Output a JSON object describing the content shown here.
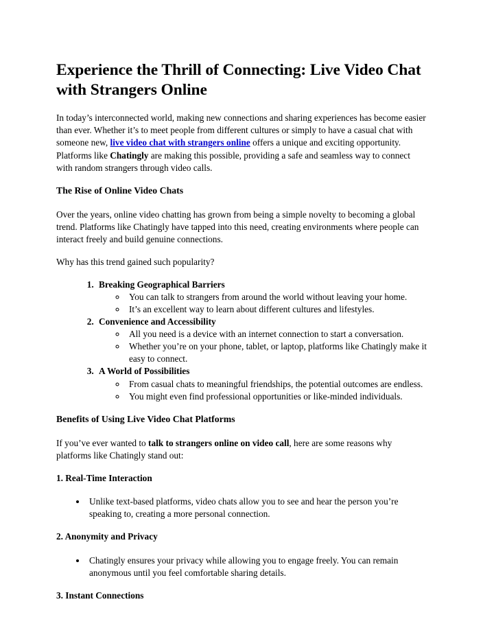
{
  "document": {
    "title": "Experience the Thrill of Connecting: Live Video Chat with Strangers Online",
    "intro": {
      "part1": "In today’s interconnected world, making new connections and sharing experiences has become easier than ever. Whether it’s to meet people from different cultures or simply to have a casual chat with someone new, ",
      "link_text": "live video chat with strangers online",
      "part2": " offers a unique and exciting opportunity. Platforms like ",
      "bold_brand": "Chatingly",
      "part3": " are making this possible, providing a safe and seamless way to connect with random strangers through video calls."
    },
    "section_rise": {
      "heading": "The Rise of Online Video Chats",
      "paragraph": "Over the years, online video chatting has grown from being a simple novelty to becoming a global trend. Platforms like Chatingly have tapped into this need, creating environments where people can interact freely and build genuine connections.",
      "question": "Why has this trend gained such popularity?",
      "items": [
        {
          "label": "Breaking Geographical Barriers",
          "points": [
            "You can talk to strangers from around the world without leaving your home.",
            "It’s an excellent way to learn about different cultures and lifestyles."
          ]
        },
        {
          "label": "Convenience and Accessibility",
          "points": [
            "All you need is a device with an internet connection to start a conversation.",
            "Whether you’re on your phone, tablet, or laptop, platforms like Chatingly make it easy to connect."
          ]
        },
        {
          "label": "A World of Possibilities",
          "points": [
            "From casual chats to meaningful friendships, the potential outcomes are endless.",
            "You might even find professional opportunities or like-minded individuals."
          ]
        }
      ]
    },
    "section_benefits": {
      "heading": "Benefits of Using Live Video Chat Platforms",
      "lead": {
        "part1": "If you’ve ever wanted to ",
        "bold_phrase": "talk to strangers online on video call",
        "part2": ", here are some reasons why platforms like Chatingly stand out:"
      },
      "subsections": [
        {
          "heading": "1. Real-Time Interaction",
          "points": [
            "Unlike text-based platforms, video chats allow you to see and hear the person you’re speaking to, creating a more personal connection."
          ]
        },
        {
          "heading": "2. Anonymity and Privacy",
          "points": [
            "Chatingly ensures your privacy while allowing you to engage freely. You can remain anonymous until you feel comfortable sharing details."
          ]
        },
        {
          "heading": "3. Instant Connections",
          "points": []
        }
      ]
    }
  }
}
